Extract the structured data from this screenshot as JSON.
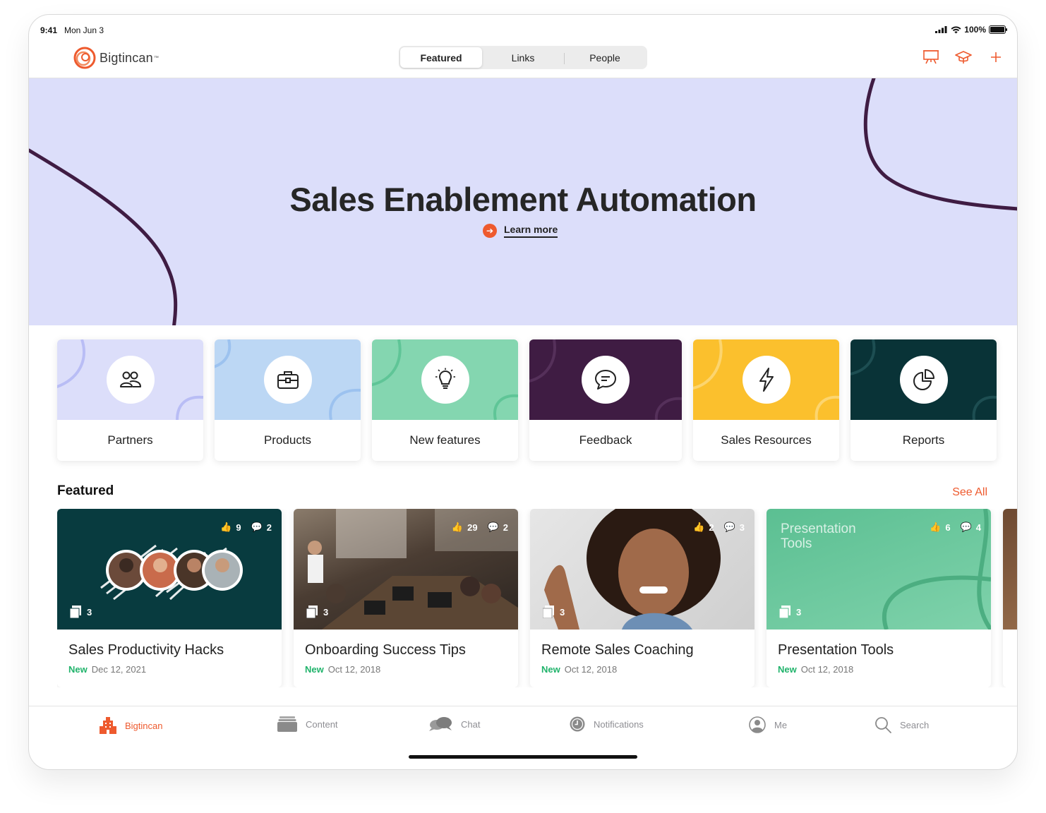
{
  "status_bar": {
    "time": "9:41",
    "date": "Mon Jun 3",
    "battery": "100%"
  },
  "app": {
    "logo_text": "Bigtincan",
    "logo_mark": "™"
  },
  "segmented": {
    "items": [
      {
        "label": "Featured",
        "active": true
      },
      {
        "label": "Links"
      },
      {
        "label": "People"
      }
    ]
  },
  "top_actions": [
    "presentation-icon",
    "graduation-cap-icon",
    "plus-icon"
  ],
  "hero": {
    "title": "Sales Enablement Automation",
    "link": "Learn more",
    "background": "#dcdefa",
    "stroke": "#3f1c43"
  },
  "categories": [
    {
      "label": "Partners",
      "color": "#dcdefa",
      "icon": "people-icon"
    },
    {
      "label": "Products",
      "color": "#bcd7f4",
      "icon": "briefcase-icon"
    },
    {
      "label": "New features",
      "color": "#84d6b0",
      "icon": "lightbulb-icon"
    },
    {
      "label": "Feedback",
      "color": "#3f1c43",
      "icon": "chat-bubble-icon"
    },
    {
      "label": "Sales Resources",
      "color": "#fbc02d",
      "icon": "lightning-icon"
    },
    {
      "label": "Reports",
      "color": "#093337",
      "icon": "pie-chart-icon"
    }
  ],
  "featured": {
    "title": "Featured",
    "see_all": "See All",
    "cards": [
      {
        "title": "Sales Productivity Hacks",
        "badge": "New",
        "date": "Dec 12, 2021",
        "likes": "9",
        "comments": "2",
        "files": "3"
      },
      {
        "title": "Onboarding Success Tips",
        "badge": "New",
        "date": "Oct 12, 2018",
        "likes": "29",
        "comments": "2",
        "files": "3"
      },
      {
        "title": "Remote Sales Coaching",
        "badge": "New",
        "date": "Oct 12, 2018",
        "likes": "2",
        "comments": "3",
        "files": "3"
      },
      {
        "title": "Presentation Tools",
        "badge": "New",
        "date": "Oct 12, 2018",
        "likes": "6",
        "comments": "4",
        "files": "3",
        "overlay": "Presentation Tools"
      }
    ]
  },
  "tabbar": [
    {
      "label": "Bigtincan",
      "icon": "building-icon",
      "active": true
    },
    {
      "label": "Content",
      "icon": "folder-icon"
    },
    {
      "label": "Chat",
      "icon": "chat-icon"
    },
    {
      "label": "Notifications",
      "icon": "clock-icon"
    },
    {
      "label": "Me",
      "icon": "user-icon"
    },
    {
      "label": "Search",
      "icon": "search-icon"
    }
  ],
  "colors": {
    "accent": "#ee5a2e",
    "new_badge": "#20b36b"
  }
}
